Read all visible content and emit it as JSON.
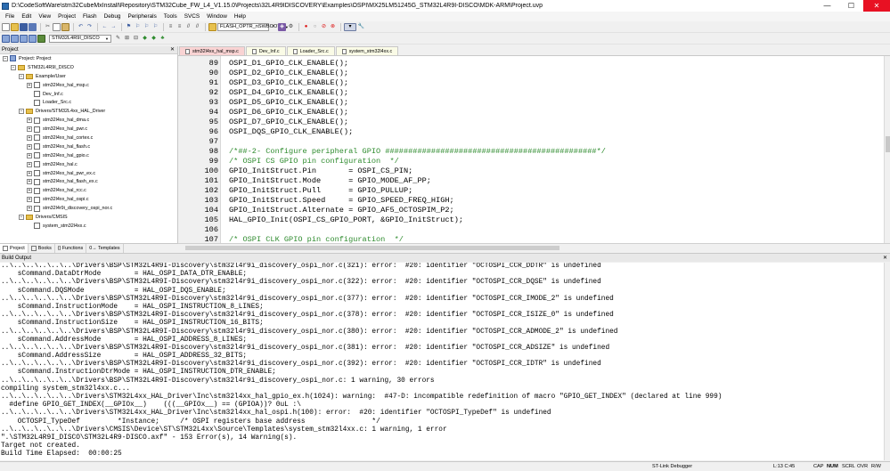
{
  "window": {
    "title": "D:\\CodeSoftWare\\stm32CubeMxInstall\\Repository\\STM32Cube_FW_L4_V1.15.0\\Projects\\32L4R9IDISCOVERY\\Examples\\OSPI\\MX25LM51245G_STM32L4R9I-DISCO\\MDK-ARM\\Project.uvp",
    "minimize": "—",
    "maximize": "☐",
    "close": "✕"
  },
  "menu": [
    "File",
    "Edit",
    "View",
    "Project",
    "Flash",
    "Debug",
    "Peripherals",
    "Tools",
    "SVCS",
    "Window",
    "Help"
  ],
  "toolbar": {
    "find_combo": "FLASH_OPTR_nSWBOOT0",
    "target_combo": "STM32L4R9I_DISCO"
  },
  "project_panel": {
    "title": "Project",
    "close": "✕",
    "tree": [
      {
        "label": "Project: Project",
        "level": 0,
        "type": "proj",
        "expand": "−"
      },
      {
        "label": "STM32L4R9I_DISCO",
        "level": 1,
        "type": "folder",
        "expand": "−"
      },
      {
        "label": "Example/User",
        "level": 2,
        "type": "folder",
        "expand": "−"
      },
      {
        "label": "stm32l4xx_hal_msp.c",
        "level": 3,
        "type": "file",
        "expand": "+"
      },
      {
        "label": "Dev_Inf.c",
        "level": 3,
        "type": "file",
        "expand": ""
      },
      {
        "label": "Loader_Src.c",
        "level": 3,
        "type": "file",
        "expand": ""
      },
      {
        "label": "Drivers/STM32L4xx_HAL_Driver",
        "level": 2,
        "type": "folder",
        "expand": "−"
      },
      {
        "label": "stm32l4xx_hal_dma.c",
        "level": 3,
        "type": "file",
        "expand": "+"
      },
      {
        "label": "stm32l4xx_hal_pwr.c",
        "level": 3,
        "type": "file",
        "expand": "+"
      },
      {
        "label": "stm32l4xx_hal_cortex.c",
        "level": 3,
        "type": "file",
        "expand": "+"
      },
      {
        "label": "stm32l4xx_hal_flash.c",
        "level": 3,
        "type": "file",
        "expand": "+"
      },
      {
        "label": "stm32l4xx_hal_gpio.c",
        "level": 3,
        "type": "file",
        "expand": "+"
      },
      {
        "label": "stm32l4xx_hal.c",
        "level": 3,
        "type": "file",
        "expand": "+"
      },
      {
        "label": "stm32l4xx_hal_pwr_ex.c",
        "level": 3,
        "type": "file",
        "expand": "+"
      },
      {
        "label": "stm32l4xx_hal_flash_ex.c",
        "level": 3,
        "type": "file",
        "expand": "+"
      },
      {
        "label": "stm32l4xx_hal_rcc.c",
        "level": 3,
        "type": "file",
        "expand": "+"
      },
      {
        "label": "stm32l4xx_hal_ospi.c",
        "level": 3,
        "type": "file",
        "expand": "+"
      },
      {
        "label": "stm32l4r9i_discovery_ospi_nor.c",
        "level": 3,
        "type": "file",
        "expand": "+"
      },
      {
        "label": "Drivers/CMSIS",
        "level": 2,
        "type": "folder",
        "expand": "−"
      },
      {
        "label": "system_stm32l4xx.c",
        "level": 3,
        "type": "file",
        "expand": ""
      }
    ],
    "tabs": [
      "Project",
      "Books",
      "{} Functions",
      "0→ Templates"
    ]
  },
  "editor": {
    "tabs": [
      "stm32l4xx_hal_msp.c",
      "Dev_Inf.c",
      "Loader_Src.c",
      "system_stm32l4xx.c"
    ],
    "lines": [
      {
        "n": "89",
        "code": "OSPI_D1_GPIO_CLK_ENABLE();",
        "c": false
      },
      {
        "n": "90",
        "code": "OSPI_D2_GPIO_CLK_ENABLE();",
        "c": false
      },
      {
        "n": "91",
        "code": "OSPI_D3_GPIO_CLK_ENABLE();",
        "c": false
      },
      {
        "n": "92",
        "code": "OSPI_D4_GPIO_CLK_ENABLE();",
        "c": false
      },
      {
        "n": "93",
        "code": "OSPI_D5_GPIO_CLK_ENABLE();",
        "c": false
      },
      {
        "n": "94",
        "code": "OSPI_D6_GPIO_CLK_ENABLE();",
        "c": false
      },
      {
        "n": "95",
        "code": "OSPI_D7_GPIO_CLK_ENABLE();",
        "c": false
      },
      {
        "n": "96",
        "code": "OSPI_DQS_GPIO_CLK_ENABLE();",
        "c": false
      },
      {
        "n": "97",
        "code": "",
        "c": false
      },
      {
        "n": "98",
        "code": "/*##-2- Configure peripheral GPIO ##############################################*/",
        "c": true
      },
      {
        "n": "99",
        "code": "/* OSPI CS GPIO pin configuration  */",
        "c": true
      },
      {
        "n": "100",
        "code": "GPIO_InitStruct.Pin       = OSPI_CS_PIN;",
        "c": false
      },
      {
        "n": "101",
        "code": "GPIO_InitStruct.Mode      = GPIO_MODE_AF_PP;",
        "c": false
      },
      {
        "n": "102",
        "code": "GPIO_InitStruct.Pull      = GPIO_PULLUP;",
        "c": false
      },
      {
        "n": "103",
        "code": "GPIO_InitStruct.Speed     = GPIO_SPEED_FREQ_HIGH;",
        "c": false
      },
      {
        "n": "104",
        "code": "GPIO_InitStruct.Alternate = GPIO_AF5_OCTOSPIM_P2;",
        "c": false
      },
      {
        "n": "105",
        "code": "HAL_GPIO_Init(OSPI_CS_GPIO_PORT, &GPIO_InitStruct);",
        "c": false
      },
      {
        "n": "106",
        "code": "",
        "c": false
      },
      {
        "n": "107",
        "code": "/* OSPI CLK GPIO pin configuration  */",
        "c": true
      }
    ]
  },
  "build_output": {
    "title": "Build Output",
    "close": "✕",
    "lines": [
      "..\\..\\..\\..\\..\\..\\Drivers\\BSP\\STM32L4R9I-Discovery\\stm32l4r9i_discovery_ospi_nor.c(321): error:  #20: identifier \"OCTOSPI_CCR_DDTR\" is undefined",
      "    sCommand.DataDtrMode        = HAL_OSPI_DATA_DTR_ENABLE;",
      "..\\..\\..\\..\\..\\..\\Drivers\\BSP\\STM32L4R9I-Discovery\\stm32l4r9i_discovery_ospi_nor.c(322): error:  #20: identifier \"OCTOSPI_CCR_DQSE\" is undefined",
      "    sCommand.DQSMode            = HAL_OSPI_DQS_ENABLE;",
      "..\\..\\..\\..\\..\\..\\Drivers\\BSP\\STM32L4R9I-Discovery\\stm32l4r9i_discovery_ospi_nor.c(377): error:  #20: identifier \"OCTOSPI_CCR_IMODE_2\" is undefined",
      "    sCommand.InstructionMode    = HAL_OSPI_INSTRUCTION_8_LINES;",
      "..\\..\\..\\..\\..\\..\\Drivers\\BSP\\STM32L4R9I-Discovery\\stm32l4r9i_discovery_ospi_nor.c(378): error:  #20: identifier \"OCTOSPI_CCR_ISIZE_0\" is undefined",
      "    sCommand.InstructionSize    = HAL_OSPI_INSTRUCTION_16_BITS;",
      "..\\..\\..\\..\\..\\..\\Drivers\\BSP\\STM32L4R9I-Discovery\\stm32l4r9i_discovery_ospi_nor.c(380): error:  #20: identifier \"OCTOSPI_CCR_ADMODE_2\" is undefined",
      "    sCommand.AddressMode        = HAL_OSPI_ADDRESS_8_LINES;",
      "..\\..\\..\\..\\..\\..\\Drivers\\BSP\\STM32L4R9I-Discovery\\stm32l4r9i_discovery_ospi_nor.c(381): error:  #20: identifier \"OCTOSPI_CCR_ADSIZE\" is undefined",
      "    sCommand.AddressSize        = HAL_OSPI_ADDRESS_32_BITS;",
      "..\\..\\..\\..\\..\\..\\Drivers\\BSP\\STM32L4R9I-Discovery\\stm32l4r9i_discovery_ospi_nor.c(392): error:  #20: identifier \"OCTOSPI_CCR_IDTR\" is undefined",
      "    sCommand.InstructionDtrMode = HAL_OSPI_INSTRUCTION_DTR_ENABLE;",
      "..\\..\\..\\..\\..\\..\\Drivers\\BSP\\STM32L4R9I-Discovery\\stm32l4r9i_discovery_ospi_nor.c: 1 warning, 30 errors",
      "compiling system_stm32l4xx.c...",
      "..\\..\\..\\..\\..\\..\\Drivers\\STM32L4xx_HAL_Driver\\Inc\\stm32l4xx_hal_gpio_ex.h(1024): warning:  #47-D: incompatible redefinition of macro \"GPIO_GET_INDEX\" (declared at line 999)",
      "  #define GPIO_GET_INDEX(__GPIOx__)    (((__GPIOx__) == (GPIOA))? 0uL :\\",
      "..\\..\\..\\..\\..\\..\\Drivers\\STM32L4xx_HAL_Driver\\Inc\\stm32l4xx_hal_ospi.h(100): error:  #20: identifier \"OCTOSPI_TypeDef\" is undefined",
      "    OCTOSPI_TypeDef         *Instance;     /* OSPI registers base address                */",
      "..\\..\\..\\..\\..\\..\\Drivers\\CMSIS\\Device\\ST\\STM32L4xx\\Source\\Templates\\system_stm32l4xx.c: 1 warning, 1 error",
      "\".\\STM32L4R9I_DISCO\\STM32L4R9-DISCO.axf\" - 153 Error(s), 14 Warning(s).",
      "Target not created.",
      "Build Time Elapsed:  00:00:25"
    ]
  },
  "status": {
    "debugger": "ST-Link Debugger",
    "position": "L:13 C:45",
    "cap": "CAP",
    "num": "NUM",
    "scrl": "SCRL",
    "ovr": "OVR",
    "rw": "R/W"
  }
}
